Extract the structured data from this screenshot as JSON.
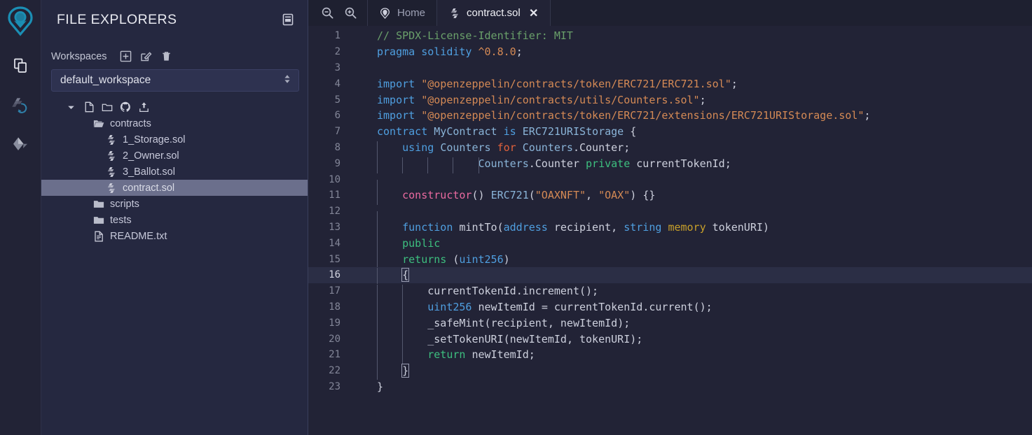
{
  "app": {
    "name": "Remix IDE",
    "bg": "#222336",
    "panel_bg": "#252840",
    "accent": "#1b8fb5",
    "selected_bg": "#6b6f8c"
  },
  "icon_rail": {
    "logo_name": "remix-logo",
    "items": [
      {
        "name": "file-explorer-icon",
        "label": "File explorers"
      },
      {
        "name": "solidity-compiler-icon",
        "label": "Solidity compiler"
      },
      {
        "name": "deploy-run-icon",
        "label": "Deploy & run transactions"
      }
    ]
  },
  "explorer": {
    "title": "FILE EXPLORERS",
    "header_icon": "book-icon",
    "workspaces_label": "Workspaces",
    "workspace_actions": [
      {
        "name": "create-workspace-icon",
        "label": "Create"
      },
      {
        "name": "rename-workspace-icon",
        "label": "Rename"
      },
      {
        "name": "delete-workspace-icon",
        "label": "Delete"
      }
    ],
    "workspace_selected": "default_workspace",
    "tree_toolbar": [
      {
        "name": "new-file-icon",
        "label": "New File"
      },
      {
        "name": "new-folder-icon",
        "label": "New Folder"
      },
      {
        "name": "github-icon",
        "label": "Clone from GitHub"
      },
      {
        "name": "publish-icon",
        "label": "Publish to Gist"
      }
    ],
    "tree": [
      {
        "label": "contracts",
        "icon": "folder-open-icon",
        "level": 0,
        "selected": false
      },
      {
        "label": "1_Storage.sol",
        "icon": "solidity-icon",
        "level": 1,
        "selected": false
      },
      {
        "label": "2_Owner.sol",
        "icon": "solidity-icon",
        "level": 1,
        "selected": false
      },
      {
        "label": "3_Ballot.sol",
        "icon": "solidity-icon",
        "level": 1,
        "selected": false
      },
      {
        "label": "contract.sol",
        "icon": "solidity-icon",
        "level": 1,
        "selected": true
      },
      {
        "label": "scripts",
        "icon": "folder-icon",
        "level": 0,
        "selected": false
      },
      {
        "label": "tests",
        "icon": "folder-icon",
        "level": 0,
        "selected": false
      },
      {
        "label": "README.txt",
        "icon": "file-icon",
        "level": 0,
        "selected": false
      }
    ]
  },
  "editor": {
    "zoom_out_label": "Zoom out",
    "zoom_in_label": "Zoom in",
    "tabs": [
      {
        "label": "Home",
        "icon": "remix-home-icon",
        "active": false,
        "closable": false
      },
      {
        "label": "contract.sol",
        "icon": "solidity-icon",
        "active": true,
        "closable": true
      }
    ],
    "close_glyph": "✕",
    "active_line": 16,
    "total_lines": 23,
    "lines": [
      {
        "n": 1,
        "text": "// SPDX-License-Identifier: MIT"
      },
      {
        "n": 2,
        "text": "pragma solidity ^0.8.0;"
      },
      {
        "n": 3,
        "text": ""
      },
      {
        "n": 4,
        "text": "import \"@openzeppelin/contracts/token/ERC721/ERC721.sol\";"
      },
      {
        "n": 5,
        "text": "import \"@openzeppelin/contracts/utils/Counters.sol\";"
      },
      {
        "n": 6,
        "text": "import \"@openzeppelin/contracts/token/ERC721/extensions/ERC721URIStorage.sol\";"
      },
      {
        "n": 7,
        "text": "contract MyContract is ERC721URIStorage {"
      },
      {
        "n": 8,
        "text": "    using Counters for Counters.Counter;"
      },
      {
        "n": 9,
        "text": "                Counters.Counter private currentTokenId;"
      },
      {
        "n": 10,
        "text": ""
      },
      {
        "n": 11,
        "text": "    constructor() ERC721(\"OAXNFT\", \"OAX\") {}"
      },
      {
        "n": 12,
        "text": ""
      },
      {
        "n": 13,
        "text": "    function mintTo(address recipient, string memory tokenURI)"
      },
      {
        "n": 14,
        "text": "    public"
      },
      {
        "n": 15,
        "text": "    returns (uint256)"
      },
      {
        "n": 16,
        "text": "    {"
      },
      {
        "n": 17,
        "text": "        currentTokenId.increment();"
      },
      {
        "n": 18,
        "text": "        uint256 newItemId = currentTokenId.current();"
      },
      {
        "n": 19,
        "text": "        _safeMint(recipient, newItemId);"
      },
      {
        "n": 20,
        "text": "        _setTokenURI(newItemId, tokenURI);"
      },
      {
        "n": 21,
        "text": "        return newItemId;"
      },
      {
        "n": 22,
        "text": "    }"
      },
      {
        "n": 23,
        "text": "}"
      }
    ],
    "syntax_colors": {
      "comment": "#6aa06a",
      "keyword": "#4f9fe0",
      "keyword_pink": "#ea6aa0",
      "string": "#d58a55",
      "type": "#4f9fe0",
      "visibility": "#3dbf7f",
      "for": "#e0613b",
      "memory": "#c8a02a",
      "plain": "#cdd0dd"
    }
  }
}
